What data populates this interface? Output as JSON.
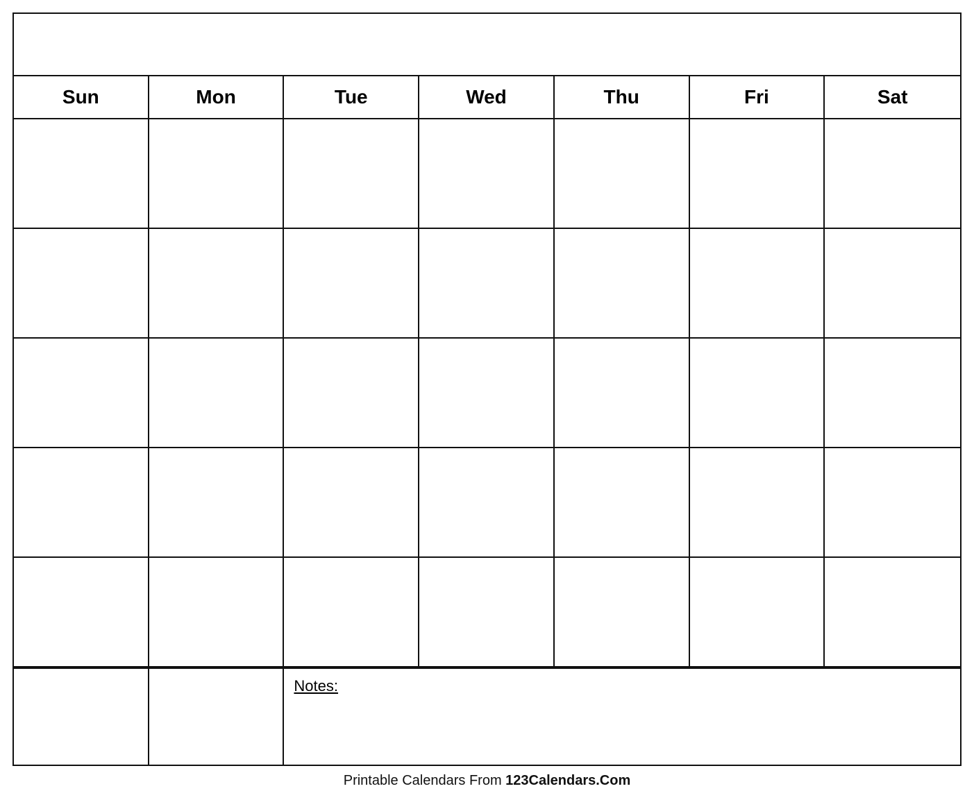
{
  "calendar": {
    "title": "",
    "days": [
      "Sun",
      "Mon",
      "Tue",
      "Wed",
      "Thu",
      "Fri",
      "Sat"
    ],
    "weeks": [
      [
        "",
        "",
        "",
        "",
        "",
        "",
        ""
      ],
      [
        "",
        "",
        "",
        "",
        "",
        "",
        ""
      ],
      [
        "",
        "",
        "",
        "",
        "",
        "",
        ""
      ],
      [
        "",
        "",
        "",
        "",
        "",
        "",
        ""
      ],
      [
        "",
        "",
        "",
        "",
        "",
        "",
        ""
      ]
    ],
    "notes_label": "Notes:"
  },
  "footer": {
    "prefix": "Printable Calendars From ",
    "brand": "123Calendars.Com"
  }
}
